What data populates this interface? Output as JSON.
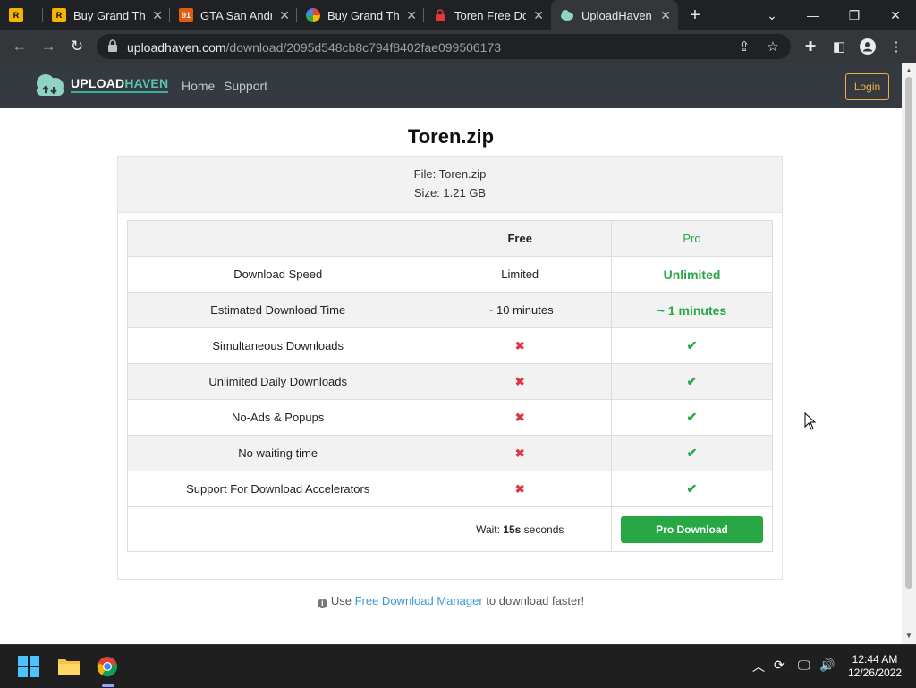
{
  "browser": {
    "tabs": [
      {
        "title": "",
        "favicon": "rockstar-icon"
      },
      {
        "title": "Buy Grand The",
        "favicon": "rockstar-icon"
      },
      {
        "title": "GTA San Andre",
        "favicon": "site-91-icon",
        "favicon_text": "91"
      },
      {
        "title": "Buy Grand The",
        "favicon": "multicolor-icon"
      },
      {
        "title": "Toren Free Do",
        "favicon": "red-lock-icon"
      },
      {
        "title": "UploadHaven",
        "favicon": "uploadhaven-icon",
        "active": true
      }
    ],
    "url_domain": "uploadhaven.com",
    "url_path": "/download/2095d548cb8c794f8402fae099506173"
  },
  "site": {
    "brand_upload": "UPLOAD",
    "brand_haven": "HAVEN",
    "nav": [
      "Home",
      "Support"
    ],
    "login_label": "Login"
  },
  "download": {
    "title": "Toren.zip",
    "file_line": "File: Toren.zip",
    "size_line": "Size: 1.21 GB",
    "table": {
      "headers": [
        "",
        "Free",
        "Pro"
      ],
      "rows": [
        {
          "feature": "Download Speed",
          "free": "Limited",
          "pro": "Unlimited"
        },
        {
          "feature": "Estimated Download Time",
          "free": "~ 10 minutes",
          "pro": "~ 1 minutes"
        },
        {
          "feature": "Simultaneous Downloads",
          "free": "cross",
          "pro": "check"
        },
        {
          "feature": "Unlimited Daily Downloads",
          "free": "cross",
          "pro": "check"
        },
        {
          "feature": "No-Ads & Popups",
          "free": "cross",
          "pro": "check"
        },
        {
          "feature": "No waiting time",
          "free": "cross",
          "pro": "check"
        },
        {
          "feature": "Support For Download Accelerators",
          "free": "cross",
          "pro": "check"
        }
      ]
    },
    "wait_prefix": "Wait:",
    "wait_value": "15s",
    "wait_suffix": "seconds",
    "pro_button": "Pro Download",
    "tip_prefix": "Use",
    "tip_link": "Free Download Manager",
    "tip_suffix": "to download faster!"
  },
  "taskbar": {
    "time": "12:44 AM",
    "date": "12/26/2022"
  },
  "colors": {
    "accent_green": "#28a745",
    "cross_red": "#dc3545",
    "login_orange": "#f0ad4e",
    "header_bg": "#343a40"
  }
}
